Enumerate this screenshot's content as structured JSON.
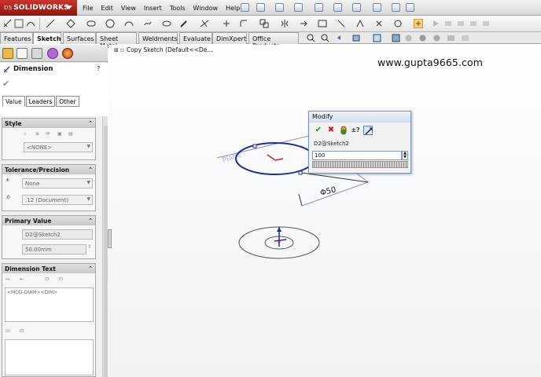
{
  "app": {
    "logo_brand": "SOLIDWORKS",
    "logo_prefix": "DS"
  },
  "menu": [
    "File",
    "Edit",
    "View",
    "Insert",
    "Tools",
    "Window",
    "Help"
  ],
  "command_tabs": [
    "Features",
    "Sketch",
    "Surfaces",
    "Sheet Metal",
    "Weldments",
    "Evaluate",
    "DimXpert",
    "Office Products"
  ],
  "active_tab": "Sketch",
  "property_manager": {
    "title": "Dimension",
    "help": "?",
    "subtabs": [
      "Value",
      "Leaders",
      "Other"
    ],
    "style": {
      "header": "Style",
      "selected": "<NONE>"
    },
    "tolerance": {
      "header": "Tolerance/Precision",
      "tolerance_type": "None",
      "precision": ".12 (Document)"
    },
    "primary_value": {
      "header": "Primary Value",
      "name": "D2@Sketch2",
      "value": "50.00mm"
    },
    "dimension_text": {
      "header": "Dimension Text",
      "text": "<MOD-DIAM><DIM>"
    }
  },
  "feature_tree": {
    "item": "Copy Sketch  (Default<<De..."
  },
  "watermark": "www.gupta9665.com",
  "modify_dialog": {
    "title": "Modify",
    "dimension_name": "D2@Sketch2",
    "value": "100"
  },
  "canvas": {
    "dimension_label": "Φ50",
    "plane_label": "Plane"
  },
  "colors": {
    "sketch_blue": "#1f2f9e",
    "origin_red": "#d42020",
    "logo_red": "#b5261e"
  }
}
